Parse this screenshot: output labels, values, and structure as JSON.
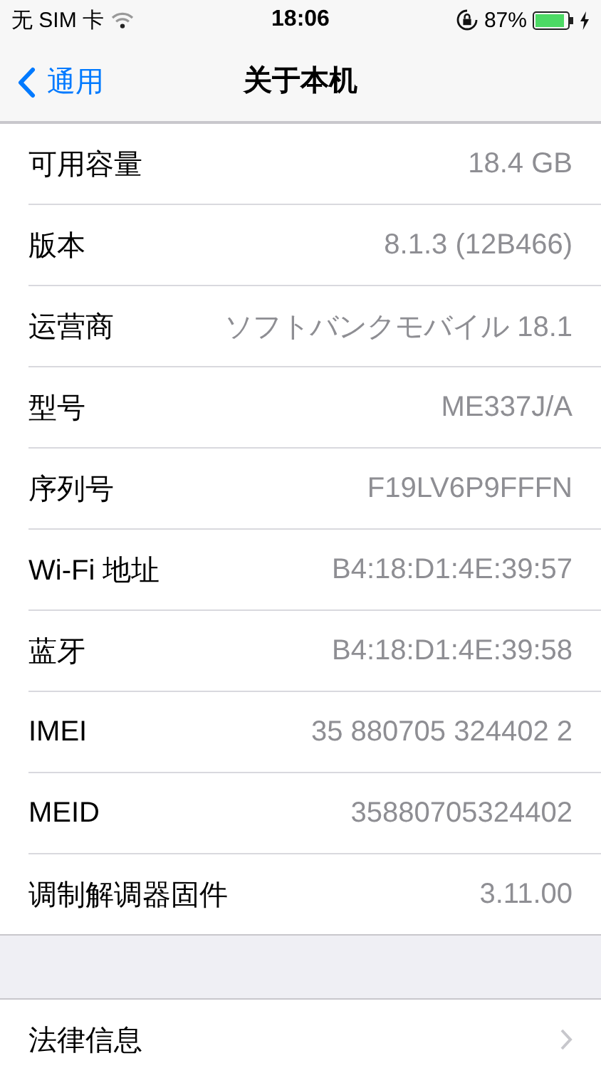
{
  "status_bar": {
    "carrier": "无 SIM 卡",
    "time": "18:06",
    "battery": "87%",
    "charging": true
  },
  "nav_bar": {
    "back": "通用",
    "title": "关于本机"
  },
  "groups": [
    {
      "rows": [
        {
          "label": "可用容量",
          "value": "18.4 GB"
        },
        {
          "label": "版本",
          "value": "8.1.3 (12B466)"
        },
        {
          "label": "运营商",
          "value": "ソフトバンクモバイル 18.1"
        },
        {
          "label": "型号",
          "value": "ME337J/A"
        },
        {
          "label": "序列号",
          "value": "F19LV6P9FFFN"
        },
        {
          "label": "Wi-Fi 地址",
          "value": "B4:18:D1:4E:39:57"
        },
        {
          "label": "蓝牙",
          "value": "B4:18:D1:4E:39:58"
        },
        {
          "label": "IMEI",
          "value": "35 880705 324402 2"
        },
        {
          "label": "MEID",
          "value": "35880705324402"
        },
        {
          "label": "调制解调器固件",
          "value": "3.11.00"
        }
      ]
    },
    {
      "rows": [
        {
          "label": "法律信息",
          "disclosure": true
        }
      ]
    }
  ]
}
